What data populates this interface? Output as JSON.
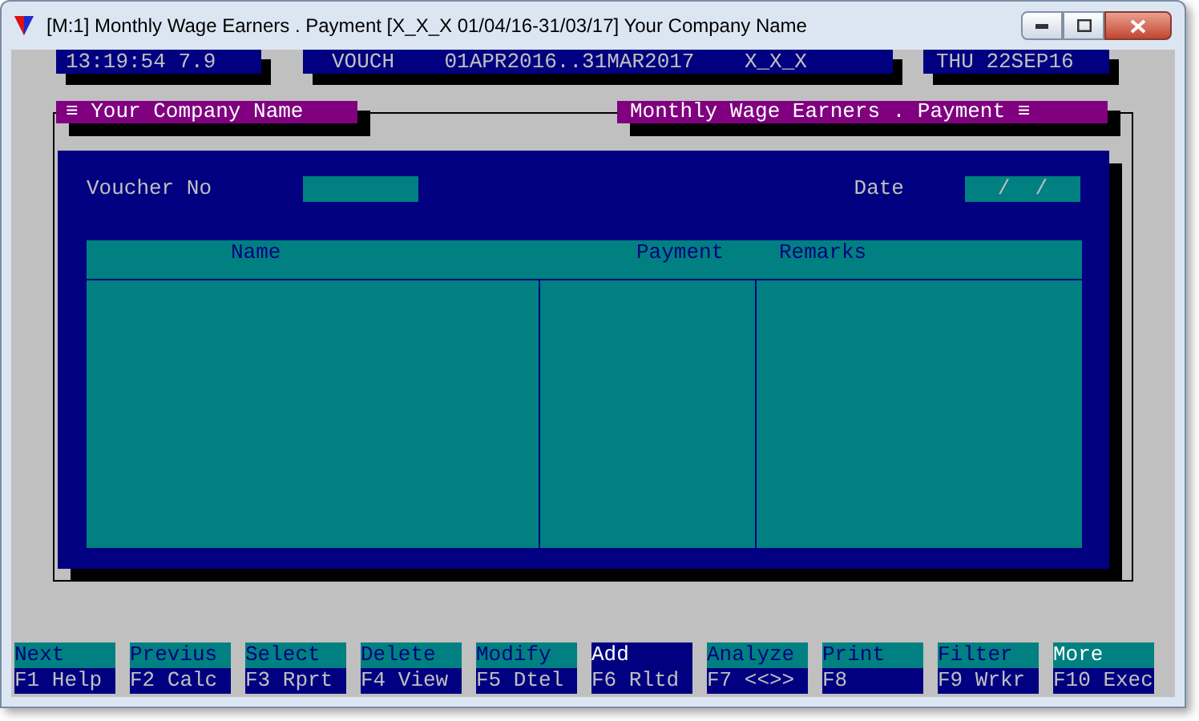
{
  "window": {
    "title": "[M:1]  Monthly Wage Earners . Payment  [X_X_X  01/04/16-31/03/17]  Your Company Name"
  },
  "status_bar": {
    "clock": "13:19:54 7.9",
    "mode": "VOUCH    01APR2016..31MAR2017    X_X_X",
    "date": "THU 22SEP16"
  },
  "panel": {
    "left_title": "≡ Your Company Name",
    "right_title": "Monthly Wage Earners . Payment ≡"
  },
  "form": {
    "voucher_label": "Voucher No",
    "date_label": "Date",
    "date_value": "/  /"
  },
  "table": {
    "columns": [
      "Name",
      "Payment",
      "Remarks"
    ]
  },
  "function_keys": [
    {
      "label": "Next",
      "key": "F1 Help",
      "kind": "normal"
    },
    {
      "label": "Previus",
      "key": "F2 Calc",
      "kind": "normal"
    },
    {
      "label": "Select",
      "key": "F3 Rprt",
      "kind": "normal"
    },
    {
      "label": "Delete",
      "key": "F4 View",
      "kind": "normal"
    },
    {
      "label": "Modify",
      "key": "F5 Dtel",
      "kind": "normal"
    },
    {
      "label": "Add",
      "key": "F6 Rltd",
      "kind": "inverse"
    },
    {
      "label": "Analyze",
      "key": "F7 <<>>",
      "kind": "normal"
    },
    {
      "label": "Print",
      "key": "F8",
      "kind": "normal"
    },
    {
      "label": "Filter",
      "key": "F9 Wrkr",
      "kind": "normal"
    },
    {
      "label": "More",
      "key": "F10 Exec",
      "kind": "bright"
    }
  ]
}
